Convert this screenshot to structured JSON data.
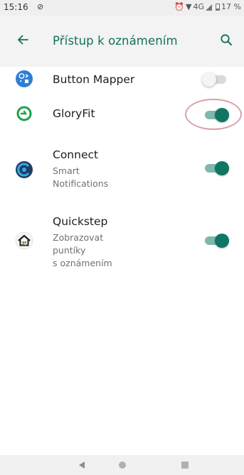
{
  "status_bar": {
    "time": "15:16",
    "sync_glyph": "⊘",
    "alarm_glyph": "⏰",
    "network": "4G",
    "battery": "17 %"
  },
  "app_bar": {
    "title": "Přístup k oznámením",
    "back_icon": "arrow-left-icon",
    "search_icon": "search-icon"
  },
  "apps": [
    {
      "name": "Button Mapper",
      "description": [],
      "enabled": false
    },
    {
      "name": "GloryFit",
      "description": [],
      "enabled": true
    },
    {
      "name": "Connect",
      "description": [
        "Smart",
        "Notifications"
      ],
      "enabled": true
    },
    {
      "name": "Quickstep",
      "description": [
        "Zobrazovat",
        "puntíky",
        "s oznámením"
      ],
      "enabled": true
    }
  ],
  "colors": {
    "accent": "#12705f",
    "toggle_on": "#0f7663",
    "toggle_on_track": "#7fb7ac",
    "highlight": "#d9a2a6"
  },
  "nav_bar": {
    "back": "nav-back-icon",
    "home": "nav-home-icon",
    "recents": "nav-recents-icon"
  }
}
